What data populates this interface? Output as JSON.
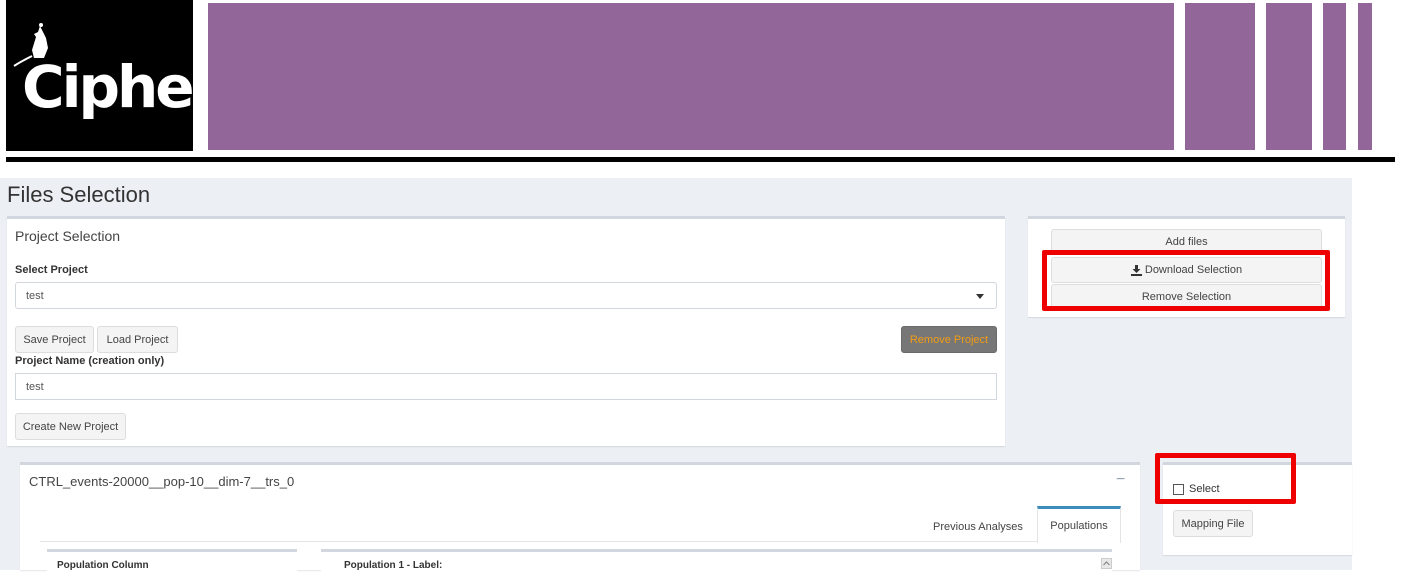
{
  "brand": {
    "logo_text": "Ciphe",
    "bar_color": "#926699"
  },
  "page": {
    "title": "Files Selection"
  },
  "project_panel": {
    "title": "Project Selection",
    "select_label": "Select Project",
    "selected_project": "test",
    "save_label": "Save Project",
    "load_label": "Load Project",
    "remove_label": "Remove Project",
    "name_label": "Project Name (creation only)",
    "name_value": "test",
    "create_label": "Create New Project"
  },
  "files_panel": {
    "add_label": "Add files",
    "download_label": "Download Selection",
    "remove_label": "Remove Selection"
  },
  "file_card": {
    "title": "CTRL_events-20000__pop-10__dim-7__trs_0",
    "collapse_symbol": "−",
    "tabs": [
      "Previous Analyses",
      "Populations"
    ],
    "active_tab": "Populations",
    "population_column_label": "Population Column",
    "population_label": "Population 1 - Label:"
  },
  "side_panel": {
    "select_label": "Select",
    "select_checked": false,
    "mapping_label": "Mapping File"
  },
  "colors": {
    "highlight": "#ee0000",
    "remove_button_bg": "#777777",
    "remove_button_text": "#f39c12",
    "active_tab": "#3c8dbc"
  }
}
